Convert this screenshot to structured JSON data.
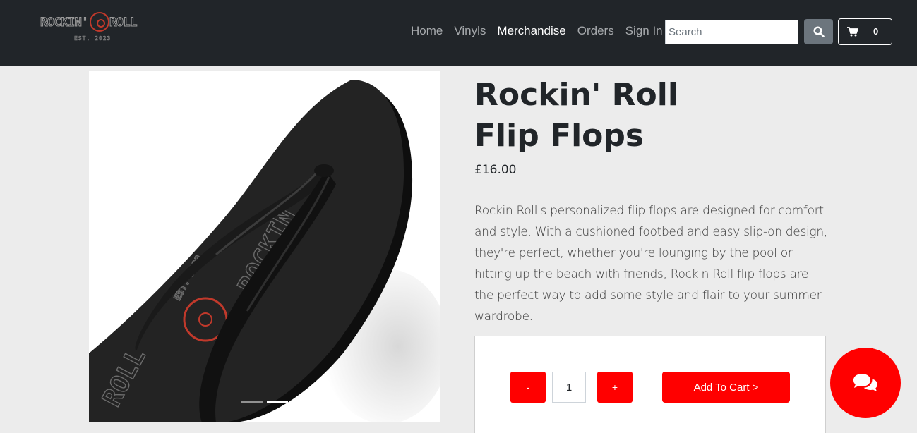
{
  "header": {
    "logo": {
      "left_text": "ROCKIN'",
      "right_text": "ROLL",
      "sub_text": "EST. 2023"
    },
    "nav": [
      {
        "label": "Home",
        "active": false
      },
      {
        "label": "Vinyls",
        "active": false
      },
      {
        "label": "Merchandise",
        "active": true
      },
      {
        "label": "Orders",
        "active": false
      },
      {
        "label": "Sign In",
        "active": false
      }
    ],
    "search": {
      "placeholder": "Search",
      "value": ""
    },
    "cart": {
      "count": "0"
    }
  },
  "product": {
    "title_line1": "Rockin' Roll",
    "title_line2": "Flip Flops",
    "price": "£16.00",
    "description": "Rockin Roll's personalized flip flops are designed for comfort and style. With a cushioned footbed and easy slip-on design, they're perfect, whether you're lounging by the pool or hitting up the beach with friends, Rockin Roll flip flops are the perfect way to add some style and flair to your summer wardrobe.",
    "image_print_text": {
      "brand": "ROCKIN'",
      "roll": "ROLL",
      "est": "EST. 2023"
    },
    "carousel": {
      "slides": 2,
      "active_index": 1
    }
  },
  "cart_panel": {
    "minus_label": "-",
    "quantity": "1",
    "plus_label": "+",
    "add_label": "Add To Cart  >"
  },
  "colors": {
    "navbar_bg": "#212529",
    "accent_red": "#ff0000",
    "page_bg": "#ececec"
  },
  "icons": [
    "search-icon",
    "shopping-cart-icon",
    "chat-bubbles-icon"
  ]
}
